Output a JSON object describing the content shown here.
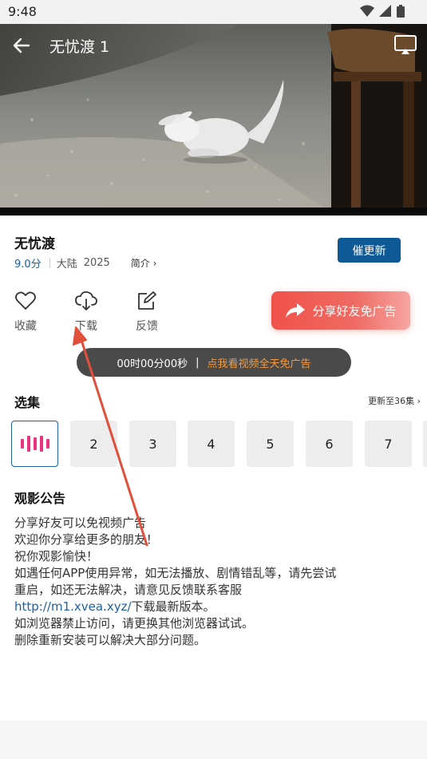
{
  "status_bar": {
    "time": "9:48"
  },
  "player": {
    "title": "无忧渡 1"
  },
  "show": {
    "title": "无忧渡",
    "score": "9.0分",
    "region": "大陆",
    "year": "2025",
    "intro_label": "简介 ›",
    "urge_label": "催更新"
  },
  "actions": {
    "favorite_label": "收藏",
    "download_label": "下载",
    "feedback_label": "反馈",
    "share_label": "分享好友免广告"
  },
  "timer": {
    "time_text": "00时00分00秒",
    "divider": "|",
    "promo_text": "点我看视频全天免广告"
  },
  "episodes": {
    "title": "选集",
    "update_text": "更新至36集 ›",
    "items": [
      "2",
      "3",
      "4",
      "5",
      "6",
      "7"
    ]
  },
  "notice": {
    "title": "观影公告",
    "lines": [
      "分享好友可以免视频广告",
      "欢迎你分享给更多的朋友！",
      "祝你观影愉快！",
      "如遇任何APP使用异常，如无法播放、剧情错乱等，请先尝试",
      "重启，如还无法解决，请意见反馈联系客服"
    ],
    "link_text": "http://m1.xvea.xyz/",
    "link_suffix": "下载最新版本。",
    "lines_after": [
      "如浏览器禁止访问，请更换其他浏览器试试。",
      "删除重新安装可以解决大部分问题。"
    ]
  },
  "colors": {
    "accent_blue": "#0d5a96",
    "link_blue": "#1d5fa8",
    "share_red": "#f0524a",
    "promo_orange": "#f59b3f",
    "playing_pink": "#e8357e",
    "annotation_arrow": "#e0503a"
  }
}
